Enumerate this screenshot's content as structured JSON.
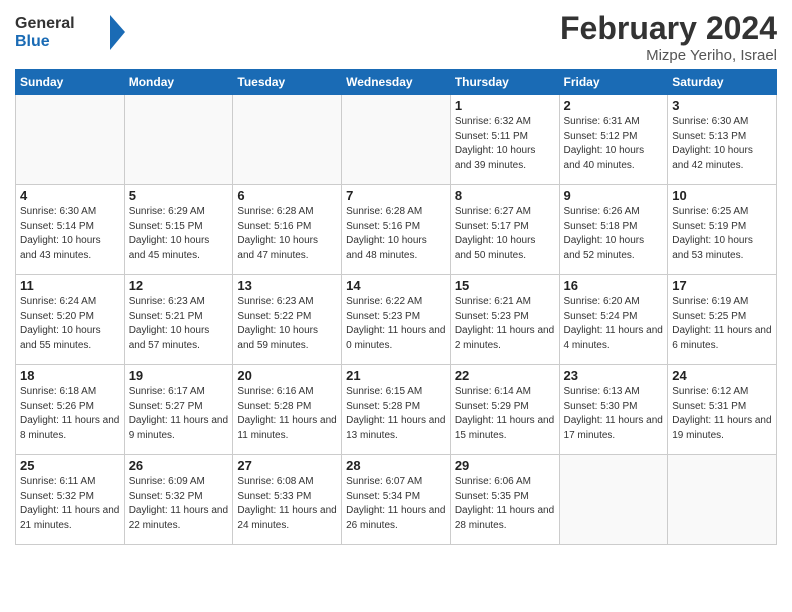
{
  "header": {
    "logo_line1": "General",
    "logo_line2": "Blue",
    "month_year": "February 2024",
    "location": "Mizpe Yeriho, Israel"
  },
  "days_of_week": [
    "Sunday",
    "Monday",
    "Tuesday",
    "Wednesday",
    "Thursday",
    "Friday",
    "Saturday"
  ],
  "weeks": [
    [
      {
        "num": "",
        "sunrise": "",
        "sunset": "",
        "daylight": "",
        "empty": true
      },
      {
        "num": "",
        "sunrise": "",
        "sunset": "",
        "daylight": "",
        "empty": true
      },
      {
        "num": "",
        "sunrise": "",
        "sunset": "",
        "daylight": "",
        "empty": true
      },
      {
        "num": "",
        "sunrise": "",
        "sunset": "",
        "daylight": "",
        "empty": true
      },
      {
        "num": "1",
        "sunrise": "6:32 AM",
        "sunset": "5:11 PM",
        "daylight": "10 hours and 39 minutes."
      },
      {
        "num": "2",
        "sunrise": "6:31 AM",
        "sunset": "5:12 PM",
        "daylight": "10 hours and 40 minutes."
      },
      {
        "num": "3",
        "sunrise": "6:30 AM",
        "sunset": "5:13 PM",
        "daylight": "10 hours and 42 minutes."
      }
    ],
    [
      {
        "num": "4",
        "sunrise": "6:30 AM",
        "sunset": "5:14 PM",
        "daylight": "10 hours and 43 minutes."
      },
      {
        "num": "5",
        "sunrise": "6:29 AM",
        "sunset": "5:15 PM",
        "daylight": "10 hours and 45 minutes."
      },
      {
        "num": "6",
        "sunrise": "6:28 AM",
        "sunset": "5:16 PM",
        "daylight": "10 hours and 47 minutes."
      },
      {
        "num": "7",
        "sunrise": "6:28 AM",
        "sunset": "5:16 PM",
        "daylight": "10 hours and 48 minutes."
      },
      {
        "num": "8",
        "sunrise": "6:27 AM",
        "sunset": "5:17 PM",
        "daylight": "10 hours and 50 minutes."
      },
      {
        "num": "9",
        "sunrise": "6:26 AM",
        "sunset": "5:18 PM",
        "daylight": "10 hours and 52 minutes."
      },
      {
        "num": "10",
        "sunrise": "6:25 AM",
        "sunset": "5:19 PM",
        "daylight": "10 hours and 53 minutes."
      }
    ],
    [
      {
        "num": "11",
        "sunrise": "6:24 AM",
        "sunset": "5:20 PM",
        "daylight": "10 hours and 55 minutes."
      },
      {
        "num": "12",
        "sunrise": "6:23 AM",
        "sunset": "5:21 PM",
        "daylight": "10 hours and 57 minutes."
      },
      {
        "num": "13",
        "sunrise": "6:23 AM",
        "sunset": "5:22 PM",
        "daylight": "10 hours and 59 minutes."
      },
      {
        "num": "14",
        "sunrise": "6:22 AM",
        "sunset": "5:23 PM",
        "daylight": "11 hours and 0 minutes."
      },
      {
        "num": "15",
        "sunrise": "6:21 AM",
        "sunset": "5:23 PM",
        "daylight": "11 hours and 2 minutes."
      },
      {
        "num": "16",
        "sunrise": "6:20 AM",
        "sunset": "5:24 PM",
        "daylight": "11 hours and 4 minutes."
      },
      {
        "num": "17",
        "sunrise": "6:19 AM",
        "sunset": "5:25 PM",
        "daylight": "11 hours and 6 minutes."
      }
    ],
    [
      {
        "num": "18",
        "sunrise": "6:18 AM",
        "sunset": "5:26 PM",
        "daylight": "11 hours and 8 minutes."
      },
      {
        "num": "19",
        "sunrise": "6:17 AM",
        "sunset": "5:27 PM",
        "daylight": "11 hours and 9 minutes."
      },
      {
        "num": "20",
        "sunrise": "6:16 AM",
        "sunset": "5:28 PM",
        "daylight": "11 hours and 11 minutes."
      },
      {
        "num": "21",
        "sunrise": "6:15 AM",
        "sunset": "5:28 PM",
        "daylight": "11 hours and 13 minutes."
      },
      {
        "num": "22",
        "sunrise": "6:14 AM",
        "sunset": "5:29 PM",
        "daylight": "11 hours and 15 minutes."
      },
      {
        "num": "23",
        "sunrise": "6:13 AM",
        "sunset": "5:30 PM",
        "daylight": "11 hours and 17 minutes."
      },
      {
        "num": "24",
        "sunrise": "6:12 AM",
        "sunset": "5:31 PM",
        "daylight": "11 hours and 19 minutes."
      }
    ],
    [
      {
        "num": "25",
        "sunrise": "6:11 AM",
        "sunset": "5:32 PM",
        "daylight": "11 hours and 21 minutes."
      },
      {
        "num": "26",
        "sunrise": "6:09 AM",
        "sunset": "5:32 PM",
        "daylight": "11 hours and 22 minutes."
      },
      {
        "num": "27",
        "sunrise": "6:08 AM",
        "sunset": "5:33 PM",
        "daylight": "11 hours and 24 minutes."
      },
      {
        "num": "28",
        "sunrise": "6:07 AM",
        "sunset": "5:34 PM",
        "daylight": "11 hours and 26 minutes."
      },
      {
        "num": "29",
        "sunrise": "6:06 AM",
        "sunset": "5:35 PM",
        "daylight": "11 hours and 28 minutes."
      },
      {
        "num": "",
        "sunrise": "",
        "sunset": "",
        "daylight": "",
        "empty": true
      },
      {
        "num": "",
        "sunrise": "",
        "sunset": "",
        "daylight": "",
        "empty": true
      }
    ]
  ],
  "labels": {
    "sunrise_prefix": "Sunrise: ",
    "sunset_prefix": "Sunset: ",
    "daylight_prefix": "Daylight: "
  }
}
